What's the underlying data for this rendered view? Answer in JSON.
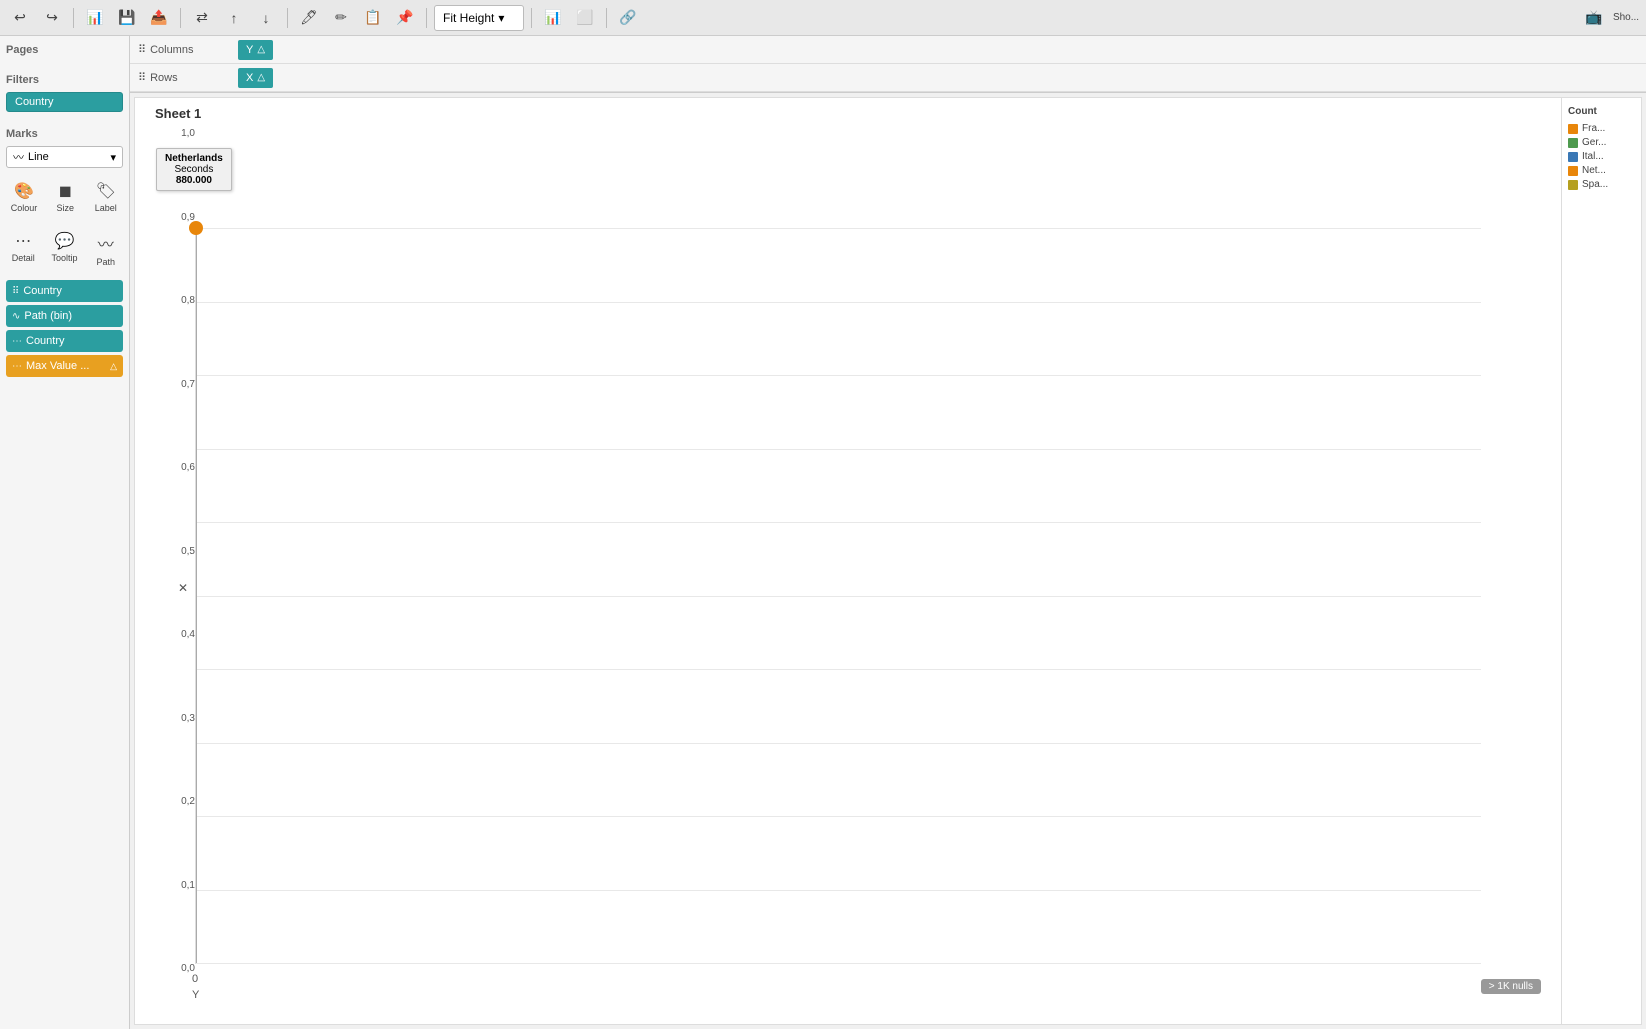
{
  "toolbar": {
    "fit_height_label": "Fit Height",
    "show_label": "Sho..."
  },
  "shelves": {
    "columns_label": "Columns",
    "rows_label": "Rows",
    "columns_pill": "Y",
    "rows_pill": "X"
  },
  "pages": {
    "title": "Pages"
  },
  "filters": {
    "title": "Filters",
    "items": [
      "Country"
    ]
  },
  "marks": {
    "title": "Marks",
    "type": "Line",
    "colour_label": "Colour",
    "size_label": "Size",
    "label_label": "Label",
    "detail_label": "Detail",
    "tooltip_label": "Tooltip",
    "path_label": "Path",
    "fields": [
      {
        "name": "Country",
        "type": "dot-grid"
      },
      {
        "name": "Path (bin)",
        "type": "path"
      },
      {
        "name": "Country",
        "type": "detail"
      },
      {
        "name": "Max Value ...",
        "type": "detail",
        "has_delta": true
      }
    ]
  },
  "sheet": {
    "title": "Sheet 1"
  },
  "chart": {
    "y_ticks": [
      "1,0",
      "0,9",
      "0,8",
      "0,7",
      "0,6",
      "0,5",
      "0,4",
      "0,3",
      "0,2",
      "0,1",
      "0,0"
    ],
    "x_tick_0": "0",
    "x_label_y": "Y",
    "null_badge": "> 1K nulls",
    "tooltip": {
      "line1": "Netherlands",
      "line2": "Seconds",
      "line3": "880.000"
    },
    "data_point": {
      "x_pct": 0,
      "y_pct": 0
    }
  },
  "legend": {
    "title": "Count",
    "items": [
      {
        "label": "Fra...",
        "color": "#e8860a"
      },
      {
        "label": "Ger...",
        "color": "#4e9a4e"
      },
      {
        "label": "Ital...",
        "color": "#3a78b5"
      },
      {
        "label": "Net...",
        "color": "#e8860a"
      },
      {
        "label": "Spa...",
        "color": "#b5a020"
      }
    ]
  }
}
